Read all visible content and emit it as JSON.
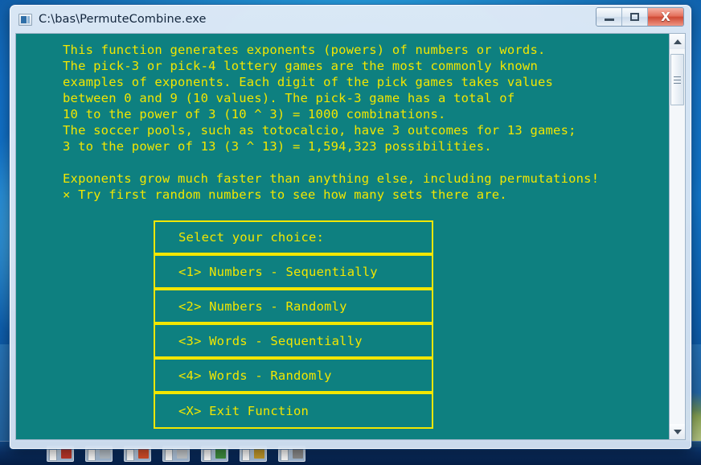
{
  "window": {
    "title": "C:\\bas\\PermuteCombine.exe",
    "icon": "console-window-icon",
    "controls": {
      "minimize": "–",
      "maximize": "□",
      "close": "X"
    }
  },
  "console": {
    "background_color": "#0e8080",
    "text_color": "#f2e600",
    "lines": [
      "This function generates exponents (powers) of numbers or words.",
      "The pick-3 or pick-4 lottery games are the most commonly known",
      "examples of exponents. Each digit of the pick games takes values",
      "between 0 and 9 (10 values). The pick-3 game has a total of",
      "10 to the power of 3 (10 ^ 3) = 1000 combinations.",
      "The soccer pools, such as totocalcio, have 3 outcomes for 13 games;",
      "3 to the power of 13 (3 ^ 13) = 1,594,323 possibilities.",
      "",
      "Exponents grow much faster than anything else, including permutations!",
      "× Try first random numbers to see how many sets there are."
    ]
  },
  "menu": {
    "border_color": "#f2e600",
    "header": "Select your choice:",
    "items": [
      {
        "label": "<1> Numbers - Sequentially"
      },
      {
        "label": "<2> Numbers - Randomly"
      },
      {
        "label": "<3> Words - Sequentially"
      },
      {
        "label": "<4> Words - Randomly"
      },
      {
        "label": "<X> Exit Function"
      }
    ]
  },
  "scrollbar": {
    "up_arrow": "scroll-up-arrow",
    "down_arrow": "scroll-down-arrow"
  },
  "taskbar": {
    "buttons": [
      {
        "color": "#c0392b"
      },
      {
        "color": "#b9c3cc"
      },
      {
        "color": "#d94f2a"
      },
      {
        "color": "#c8ccd0"
      },
      {
        "color": "#3f8f3f"
      },
      {
        "color": "#c49a2a"
      },
      {
        "color": "#8e8e8e"
      }
    ]
  }
}
